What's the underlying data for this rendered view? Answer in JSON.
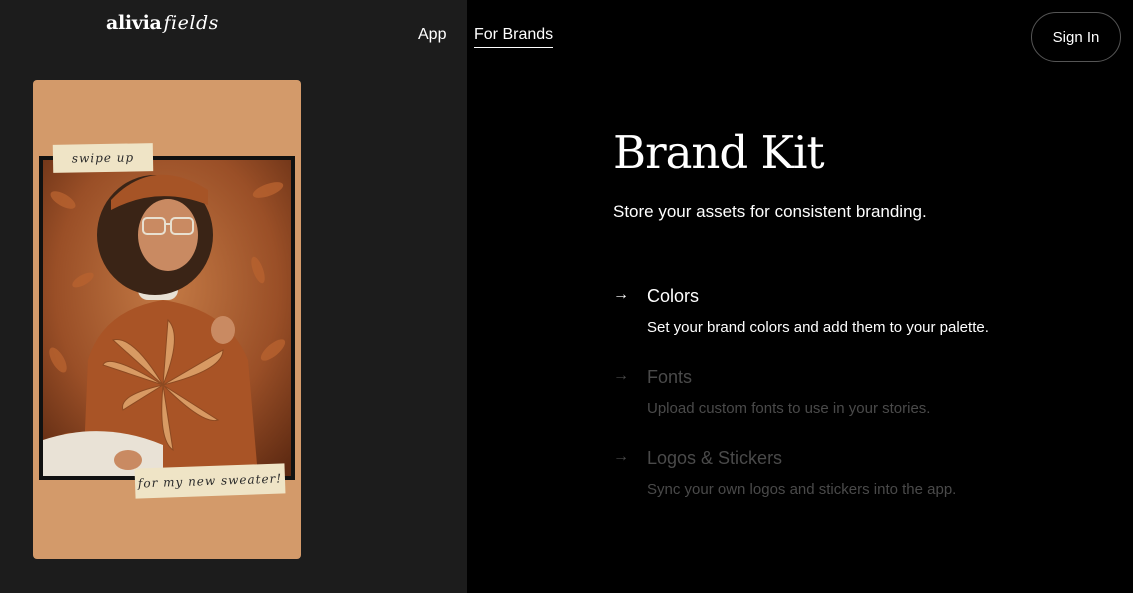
{
  "header": {
    "logo_main": "alivia",
    "logo_script": "fields",
    "nav": [
      {
        "label": "App"
      },
      {
        "label": "For Brands"
      }
    ],
    "signin_label": "Sign In"
  },
  "story": {
    "tape_top": "swipe up",
    "tape_bottom": "for my new sweater!"
  },
  "main": {
    "title": "Brand Kit",
    "subtitle": "Store your assets for consistent branding.",
    "features": [
      {
        "arrow": "→",
        "title": "Colors",
        "description": "Set your brand colors and add them to your palette.",
        "active": true
      },
      {
        "arrow": "→",
        "title": "Fonts",
        "description": "Upload custom fonts to use in your stories.",
        "active": false
      },
      {
        "arrow": "→",
        "title": "Logos & Stickers",
        "description": "Sync your own logos and stickers into the app.",
        "active": false
      }
    ]
  },
  "colors": {
    "left_bg": "#1c1c1c",
    "right_bg": "#000000",
    "card_bg": "#d39a6a",
    "tape": "#efe4c6",
    "dim_text": "#4a4a4a"
  }
}
